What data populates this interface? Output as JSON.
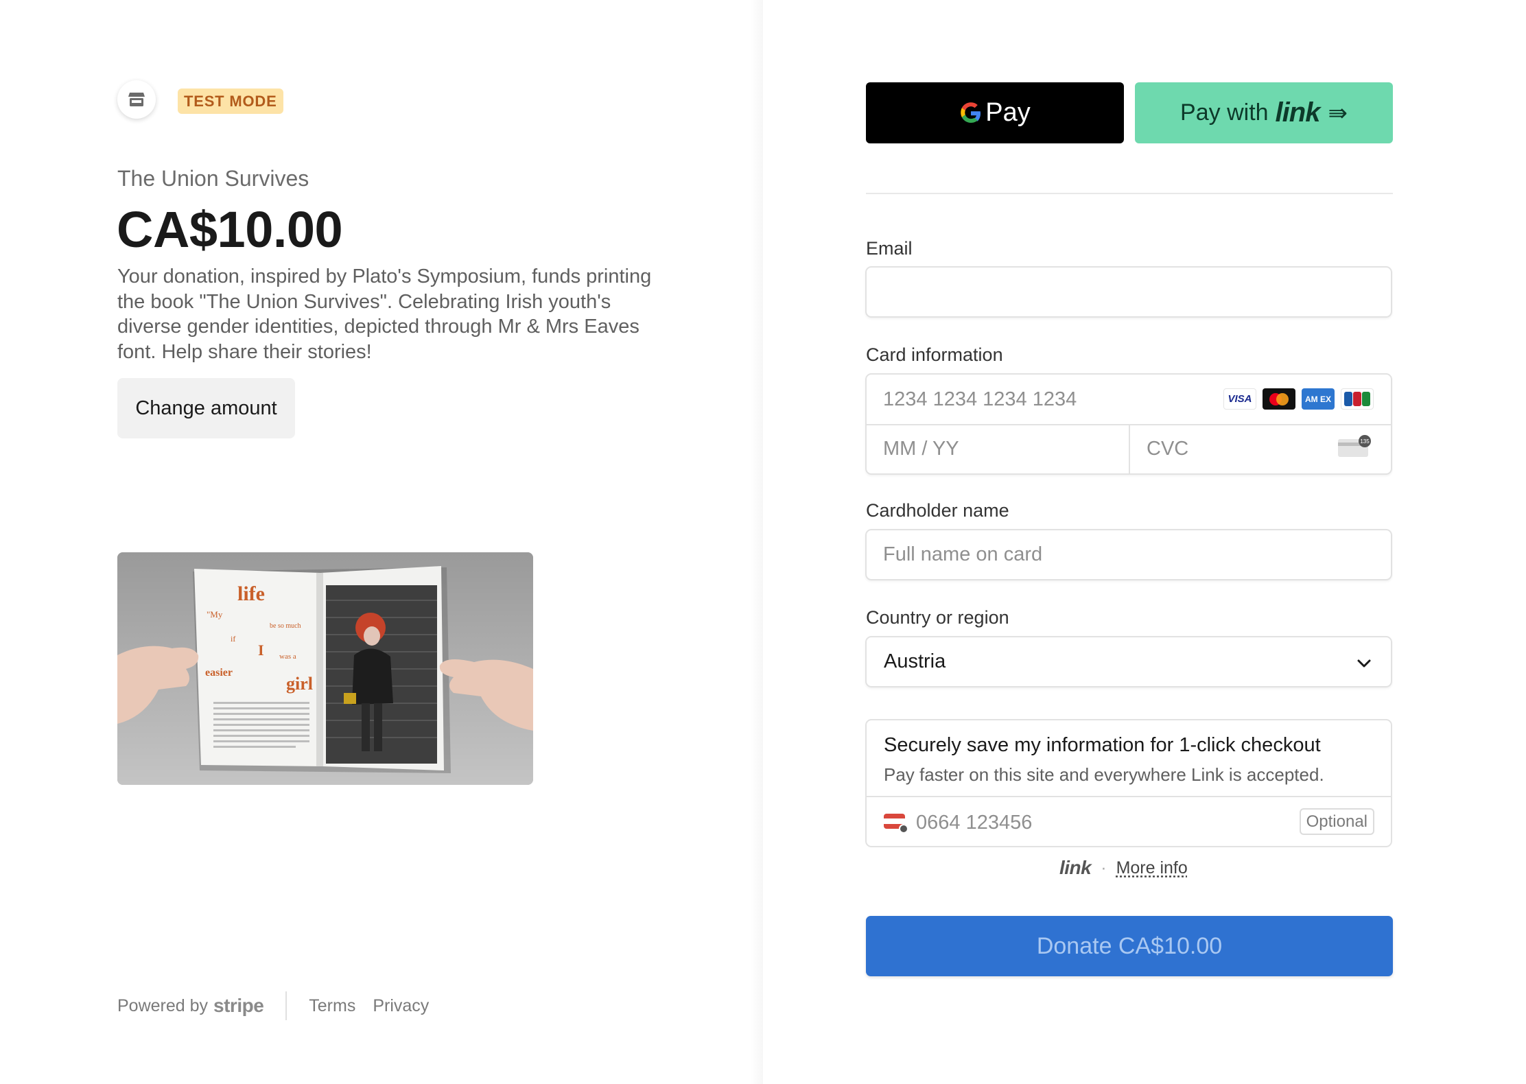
{
  "store": {
    "badge": "TEST MODE",
    "avatar_icon": "storefront-icon"
  },
  "product": {
    "name": "The Union Survives",
    "price": "CA$10.00",
    "description": "Your donation, inspired by Plato's Symposium, funds printing the book \"The Union Survives\". Celebrating Irish youth's diverse gender identities, depicted through Mr & Mrs Eaves font. Help share their stories!",
    "change_amount_label": "Change amount",
    "image_text": {
      "w1": "life",
      "w2": "\"My",
      "w3": "be so much",
      "w4": "if",
      "w5": "I",
      "w6": "was a",
      "w7": "easier",
      "w8": "girl"
    }
  },
  "footer": {
    "powered_by": "Powered by",
    "brand": "stripe",
    "terms": "Terms",
    "privacy": "Privacy"
  },
  "wallets": {
    "gpay_g": "G",
    "gpay_label": "Pay",
    "link_prefix": "Pay with",
    "link_word": "link",
    "link_arrow": "⇛"
  },
  "form": {
    "email_label": "Email",
    "email_value": "",
    "card_label": "Card information",
    "card_number_placeholder": "1234 1234 1234 1234",
    "expiry_placeholder": "MM / YY",
    "cvc_placeholder": "CVC",
    "card_brands": {
      "visa": "VISA",
      "amex": "AM EX"
    },
    "cvc_hint": "135",
    "cardholder_label": "Cardholder name",
    "cardholder_placeholder": "Full name on card",
    "country_label": "Country or region",
    "country_value": "Austria",
    "save": {
      "title": "Securely save my information for 1-click checkout",
      "subtitle": "Pay faster on this site and everywhere Link is accepted.",
      "phone_placeholder": "0664 123456",
      "optional": "Optional"
    },
    "link_footer": {
      "logo": "link",
      "separator": "·",
      "more_info": "More info"
    },
    "submit_label": "Donate CA$10.00"
  },
  "colors": {
    "donate": "#2f72d1",
    "link_green": "#6ed9ae",
    "test_badge_bg": "#fde3a7",
    "test_badge_text": "#b25b1b"
  }
}
